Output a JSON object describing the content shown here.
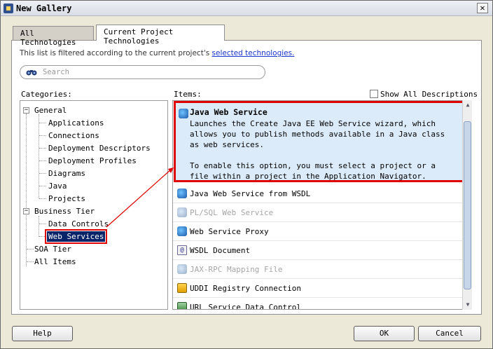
{
  "window": {
    "title": "New Gallery",
    "close_glyph": "✕"
  },
  "tabs": [
    {
      "label": "All Technologies"
    },
    {
      "label": "Current Project Technologies"
    }
  ],
  "filter": {
    "text": "This list is filtered according to the current project's ",
    "link": "selected technologies."
  },
  "search": {
    "placeholder": "Search"
  },
  "categories": {
    "label": "Categories:",
    "tree": [
      {
        "label": "General"
      },
      {
        "label": "Applications"
      },
      {
        "label": "Connections"
      },
      {
        "label": "Deployment Descriptors"
      },
      {
        "label": "Deployment Profiles"
      },
      {
        "label": "Diagrams"
      },
      {
        "label": "Java"
      },
      {
        "label": "Projects"
      },
      {
        "label": "Business Tier"
      },
      {
        "label": "Data Controls"
      },
      {
        "label": "Web Services"
      },
      {
        "label": "SOA Tier"
      },
      {
        "label": "All Items"
      }
    ]
  },
  "items": {
    "label": "Items:",
    "show_all": "Show All Descriptions",
    "selected": {
      "title": "Java Web Service",
      "description": "Launches the Create Java EE Web Service wizard, which allows you to publish methods available in a Java class as web services.",
      "note": "To enable this option, you must select a project or a file within a project in the Application Navigator."
    },
    "list": [
      {
        "label": "Java Web Service from WSDL"
      },
      {
        "label": "PL/SQL Web Service"
      },
      {
        "label": "Web Service Proxy"
      },
      {
        "label": "WSDL Document"
      },
      {
        "label": "JAX-RPC Mapping File"
      },
      {
        "label": "UDDI Registry Connection"
      },
      {
        "label": "URL Service Data Control"
      }
    ]
  },
  "buttons": {
    "help": "Help",
    "ok": "OK",
    "cancel": "Cancel"
  },
  "colors": {
    "annotation": "#e00000",
    "selection": "#0a246a",
    "link": "#1a33cc"
  }
}
